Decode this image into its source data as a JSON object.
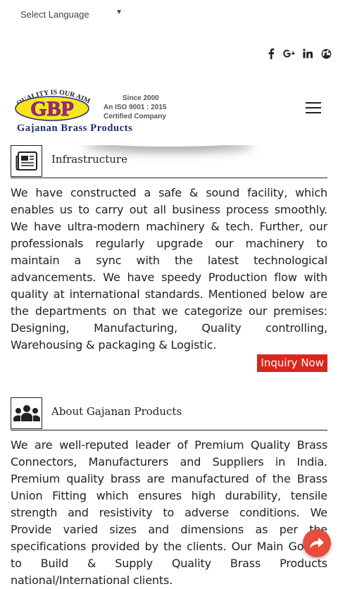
{
  "language": {
    "placeholder": "Select Language"
  },
  "social": {
    "icons": [
      "facebook-icon",
      "google-plus-icon",
      "linkedin-icon",
      "globe-icon"
    ]
  },
  "brand": {
    "tagline_arc": "QUALITY IS OUR AIM",
    "monogram": "GBP",
    "name": "Gajanan Brass Products",
    "since": "Since 2000",
    "iso": "An ISO 9001 : 2015",
    "certified": "Certified Company"
  },
  "sections": [
    {
      "icon": "newspaper-icon",
      "title": "Infrastructure",
      "body": "We have constructed a safe & sound facility, which enables us to carry out all business process smoothly. We have ultra-modern machinery & tech. Further, our professionals regularly upgrade our machinery to maintain a sync with the latest technological advancements. We have speedy Production flow with quality at international standards. Mentioned below are the departments on that we categorize our premises: Designing, Manufacturing, Quality controlling, Warehousing & packaging & Logistic.",
      "button": "Inquiry Now"
    },
    {
      "icon": "people-group-icon",
      "title": "About Gajanan Products",
      "body": "We are well-reputed leader of Premium Quality Brass Connectors, Manufacturers and Suppliers in India. Premium quality brass are manufactured of the Brass Union Fitting which ensures high durability, tensile strength and resistivity to adverse conditions. We Provide varied sizes and dimensions as per the specifications provided by the clients. Our Main Goal is to Build & Supply Quality Brass Products national/International clients."
    }
  ],
  "colors": {
    "accent_red": "#d9261c",
    "share_button": "#e84c3d"
  }
}
